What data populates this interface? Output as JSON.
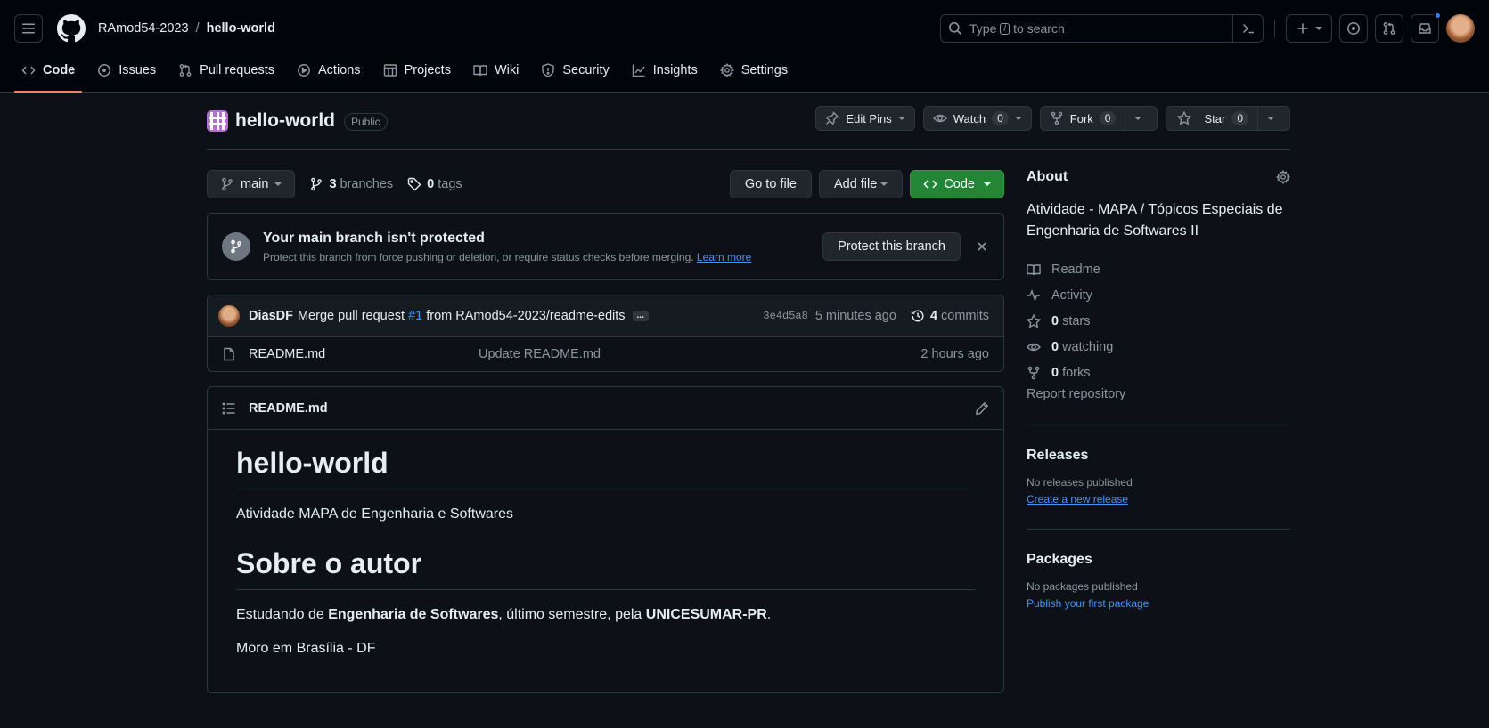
{
  "header": {
    "owner": "RAmod54-2023",
    "separator": "/",
    "repo": "hello-world",
    "search_prefix": "Type",
    "search_key": "/",
    "search_suffix": "to search"
  },
  "tabs": [
    {
      "label": "Code",
      "icon": "code-icon",
      "active": true
    },
    {
      "label": "Issues",
      "icon": "issue-icon"
    },
    {
      "label": "Pull requests",
      "icon": "pull-request-icon"
    },
    {
      "label": "Actions",
      "icon": "play-icon"
    },
    {
      "label": "Projects",
      "icon": "table-icon"
    },
    {
      "label": "Wiki",
      "icon": "book-icon"
    },
    {
      "label": "Security",
      "icon": "shield-icon"
    },
    {
      "label": "Insights",
      "icon": "graph-icon"
    },
    {
      "label": "Settings",
      "icon": "gear-icon"
    }
  ],
  "repo_header": {
    "name": "hello-world",
    "visibility": "Public",
    "edit_pins": "Edit Pins",
    "watch": "Watch",
    "watch_count": "0",
    "fork": "Fork",
    "fork_count": "0",
    "star": "Star",
    "star_count": "0"
  },
  "toolbar": {
    "branch": "main",
    "branches_count": "3",
    "branches_label": "branches",
    "tags_count": "0",
    "tags_label": "tags",
    "go_to_file": "Go to file",
    "add_file": "Add file",
    "code": "Code"
  },
  "banner": {
    "title": "Your main branch isn't protected",
    "text": "Protect this branch from force pushing or deletion, or require status checks before merging.",
    "learn_more": "Learn more",
    "protect_button": "Protect this branch"
  },
  "commit": {
    "author": "DiasDF",
    "message_prefix": "Merge pull request",
    "pr": "#1",
    "message_suffix": "from RAmod54-2023/readme-edits",
    "ellipsis": "...",
    "sha": "3e4d5a8",
    "time": "5 minutes ago",
    "commits_count": "4",
    "commits_label": "commits"
  },
  "files": [
    {
      "name": "README.md",
      "message": "Update README.md",
      "date": "2 hours ago"
    }
  ],
  "readme": {
    "title": "README.md",
    "h1": "hello-world",
    "p1": "Atividade MAPA de Engenharia e Softwares",
    "h2": "Sobre o autor",
    "p2_a": "Estudando de ",
    "p2_b": "Engenharia de Softwares",
    "p2_c": ", último semestre, pela ",
    "p2_d": "UNICESUMAR-PR",
    "p2_e": ".",
    "p3": "Moro em Brasília - DF"
  },
  "about": {
    "heading": "About",
    "description": "Atividade - MAPA / Tópicos Especiais de Engenharia de Softwares II",
    "readme": "Readme",
    "activity": "Activity",
    "stars_count": "0",
    "stars_label": "stars",
    "watching_count": "0",
    "watching_label": "watching",
    "forks_count": "0",
    "forks_label": "forks",
    "report": "Report repository"
  },
  "releases": {
    "heading": "Releases",
    "none": "No releases published",
    "create": "Create a new release"
  },
  "packages": {
    "heading": "Packages",
    "none": "No packages published",
    "publish": "Publish your first package"
  },
  "colors": {
    "background": "#0d1117",
    "header": "#010409",
    "accent_tab": "#f78166",
    "primary_button": "#238636",
    "link": "#4493f8"
  }
}
